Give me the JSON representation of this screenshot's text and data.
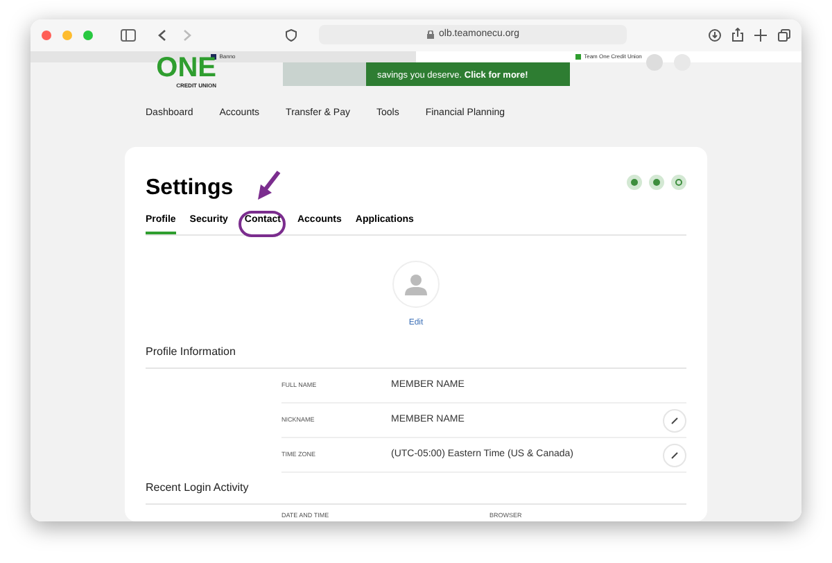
{
  "browser": {
    "url": "olb.teamonecu.org",
    "tabs": [
      {
        "label": "Banno",
        "selected": false
      },
      {
        "label": "Team One Credit Union",
        "selected": true
      }
    ]
  },
  "header": {
    "logo_word": "ONE",
    "logo_sub": "CREDIT UNION",
    "ad_text": "savings you deserve. **Click for more!**"
  },
  "nav": [
    "Dashboard",
    "Accounts",
    "Transfer & Pay",
    "Tools",
    "Financial Planning"
  ],
  "settings": {
    "title": "Settings",
    "tabs": [
      {
        "label": "Profile",
        "selected": true
      },
      {
        "label": "Security",
        "selected": false
      },
      {
        "label": "Contact",
        "selected": false
      },
      {
        "label": "Accounts",
        "selected": false
      },
      {
        "label": "Applications",
        "selected": false
      }
    ],
    "avatar_edit": "Edit",
    "profile_heading": "Profile Information",
    "fields": [
      {
        "label": "FULL NAME",
        "value": "MEMBER NAME",
        "editable": false
      },
      {
        "label": "NICKNAME",
        "value": "MEMBER NAME",
        "editable": true
      },
      {
        "label": "TIME ZONE",
        "value": "(UTC-05:00) Eastern Time (US & Canada)",
        "editable": true
      }
    ],
    "login_heading": "Recent Login Activity",
    "login_columns": [
      "DATE AND TIME",
      "BROWSER"
    ]
  }
}
